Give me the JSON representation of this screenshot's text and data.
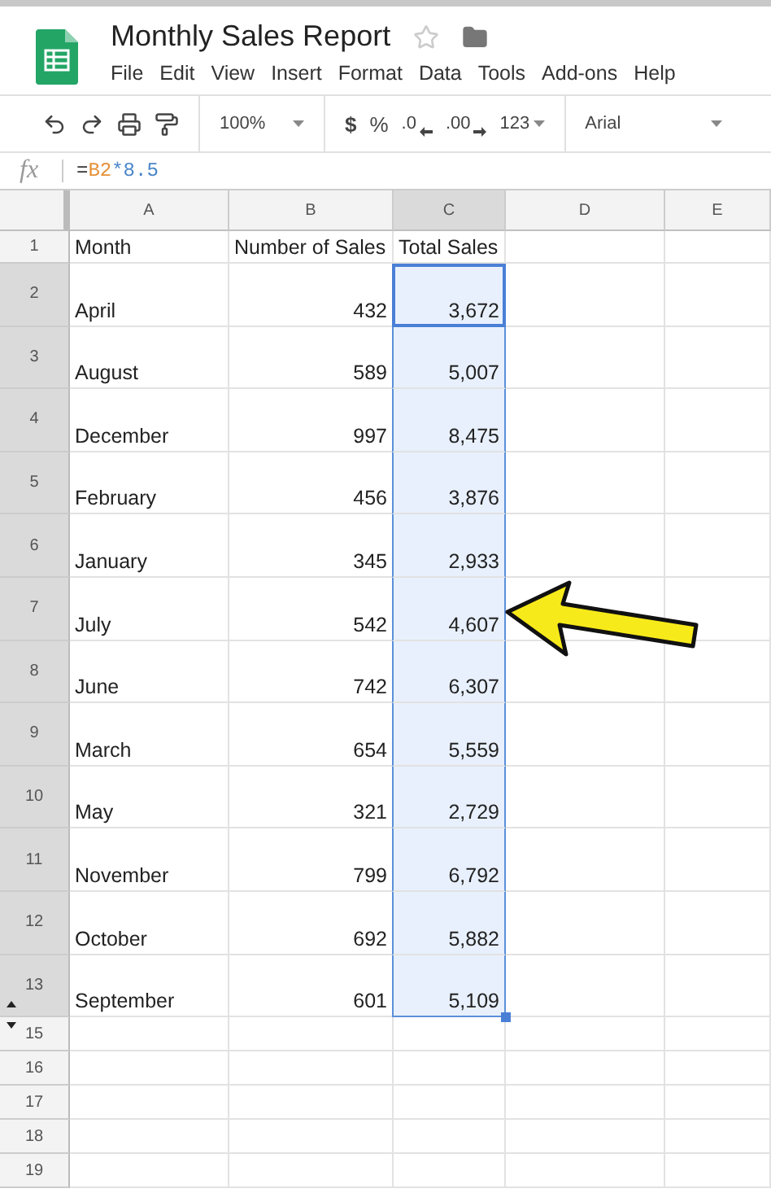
{
  "document": {
    "title": "Monthly Sales Report"
  },
  "menu": [
    "File",
    "Edit",
    "View",
    "Insert",
    "Format",
    "Data",
    "Tools",
    "Add-ons",
    "Help"
  ],
  "toolbar": {
    "zoom": "100%",
    "currency": "$",
    "percent": "%",
    "decrease_decimal": ".0",
    "increase_decimal": ".00",
    "number_format": "123",
    "font": "Arial"
  },
  "formula_bar": {
    "label": "fx",
    "parts": [
      {
        "kind": "plain",
        "text": "="
      },
      {
        "kind": "reference",
        "text": "B2"
      },
      {
        "kind": "number",
        "text": "*8.5"
      }
    ]
  },
  "columns": [
    {
      "label": "A",
      "selected": false
    },
    {
      "label": "B",
      "selected": false
    },
    {
      "label": "C",
      "selected": true
    },
    {
      "label": "D",
      "selected": false
    },
    {
      "label": "E",
      "selected": false
    }
  ],
  "rows": [
    {
      "number": "1",
      "kind": "short",
      "selected": false,
      "active": false,
      "hidden_after": false,
      "hidden_before": false,
      "cells": [
        "Month",
        "Number of Sales",
        "Total Sales"
      ]
    },
    {
      "number": "2",
      "kind": "tall",
      "selected": true,
      "active": true,
      "hidden_after": false,
      "hidden_before": false,
      "cells": [
        "April",
        "432",
        "3,672"
      ]
    },
    {
      "number": "3",
      "kind": "tall",
      "selected": true,
      "active": false,
      "hidden_after": false,
      "hidden_before": false,
      "cells": [
        "August",
        "589",
        "5,007"
      ]
    },
    {
      "number": "4",
      "kind": "tall",
      "selected": true,
      "active": false,
      "hidden_after": false,
      "hidden_before": false,
      "cells": [
        "December",
        "997",
        "8,475"
      ]
    },
    {
      "number": "5",
      "kind": "tall",
      "selected": true,
      "active": false,
      "hidden_after": false,
      "hidden_before": false,
      "cells": [
        "February",
        "456",
        "3,876"
      ]
    },
    {
      "number": "6",
      "kind": "tall",
      "selected": true,
      "active": false,
      "hidden_after": false,
      "hidden_before": false,
      "cells": [
        "January",
        "345",
        "2,933"
      ]
    },
    {
      "number": "7",
      "kind": "tall",
      "selected": true,
      "active": false,
      "hidden_after": false,
      "hidden_before": false,
      "cells": [
        "July",
        "542",
        "4,607"
      ]
    },
    {
      "number": "8",
      "kind": "tall",
      "selected": true,
      "active": false,
      "hidden_after": false,
      "hidden_before": false,
      "cells": [
        "June",
        "742",
        "6,307"
      ]
    },
    {
      "number": "9",
      "kind": "tall",
      "selected": true,
      "active": false,
      "hidden_after": false,
      "hidden_before": false,
      "cells": [
        "March",
        "654",
        "5,559"
      ]
    },
    {
      "number": "10",
      "kind": "tall",
      "selected": true,
      "active": false,
      "hidden_after": false,
      "hidden_before": false,
      "cells": [
        "May",
        "321",
        "2,729"
      ]
    },
    {
      "number": "11",
      "kind": "tall",
      "selected": true,
      "active": false,
      "hidden_after": false,
      "hidden_before": false,
      "cells": [
        "November",
        "799",
        "6,792"
      ]
    },
    {
      "number": "12",
      "kind": "tall",
      "selected": true,
      "active": false,
      "hidden_after": false,
      "hidden_before": false,
      "cells": [
        "October",
        "692",
        "5,882"
      ]
    },
    {
      "number": "13",
      "kind": "tall",
      "selected": true,
      "active": false,
      "hidden_after": true,
      "hidden_before": false,
      "cells": [
        "September",
        "601",
        "5,109"
      ]
    },
    {
      "number": "15",
      "kind": "short",
      "selected": false,
      "active": false,
      "hidden_after": false,
      "hidden_before": true
    },
    {
      "number": "16",
      "kind": "short",
      "selected": false,
      "active": false,
      "hidden_after": false,
      "hidden_before": false
    },
    {
      "number": "17",
      "kind": "short",
      "selected": false,
      "active": false,
      "hidden_after": false,
      "hidden_before": false
    },
    {
      "number": "18",
      "kind": "short",
      "selected": false,
      "active": false,
      "hidden_after": false,
      "hidden_before": false
    },
    {
      "number": "19",
      "kind": "short",
      "selected": false,
      "active": false,
      "hidden_after": false,
      "hidden_before": false
    }
  ]
}
